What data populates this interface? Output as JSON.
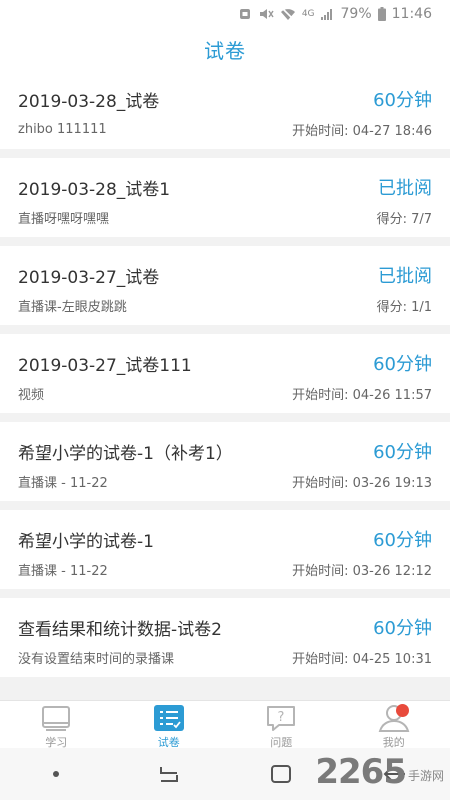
{
  "status_bar": {
    "network": "4G",
    "battery": "79%",
    "time": "11:46"
  },
  "header": {
    "title": "试卷"
  },
  "exams": [
    {
      "name": "2019-03-28_试卷",
      "status": "60分钟",
      "sub": "zhibo 111111",
      "meta": "开始时间: 04-27 18:46"
    },
    {
      "name": "2019-03-28_试卷1",
      "status": "已批阅",
      "sub": "直播呀嘿呀嘿嘿",
      "meta": "得分: 7/7"
    },
    {
      "name": "2019-03-27_试卷",
      "status": "已批阅",
      "sub": "直播课-左眼皮跳跳",
      "meta": "得分: 1/1"
    },
    {
      "name": "2019-03-27_试卷111",
      "status": "60分钟",
      "sub": "视频",
      "meta": "开始时间: 04-26 11:57"
    },
    {
      "name": "希望小学的试卷-1（补考1）",
      "status": "60分钟",
      "sub": "直播课 - 11-22",
      "meta": "开始时间: 03-26 19:13"
    },
    {
      "name": "希望小学的试卷-1",
      "status": "60分钟",
      "sub": "直播课 - 11-22",
      "meta": "开始时间: 03-26 12:12"
    },
    {
      "name": "查看结果和统计数据-试卷2",
      "status": "60分钟",
      "sub": "没有设置结束时间的录播课",
      "meta": "开始时间: 04-25 10:31"
    }
  ],
  "tabs": [
    {
      "label": "学习",
      "icon": "book-icon"
    },
    {
      "label": "试卷",
      "icon": "exam-list-icon"
    },
    {
      "label": "问题",
      "icon": "question-bubble-icon"
    },
    {
      "label": "我的",
      "icon": "user-icon"
    }
  ],
  "watermark": {
    "number": "2265",
    "text": "手游网"
  },
  "colors": {
    "accent": "#2c9bd4",
    "badge": "#e84a3c"
  }
}
